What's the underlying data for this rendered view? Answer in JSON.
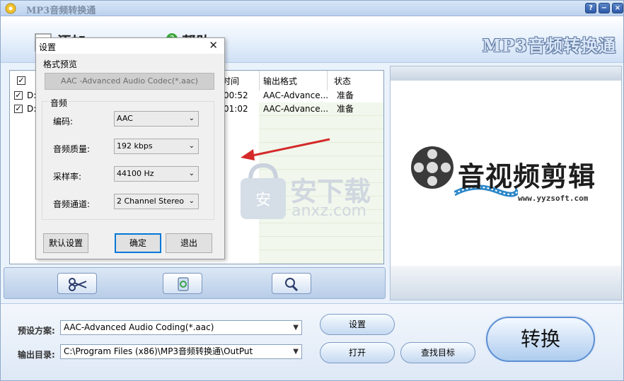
{
  "window": {
    "title": "MP3音频转换通",
    "brand_text": "MP3音频转换通",
    "controls": [
      "?",
      "−",
      "×"
    ]
  },
  "header": {
    "menu_add": "添加",
    "menu_help": "帮助"
  },
  "file_list": {
    "columns": [
      "时间",
      "输出格式",
      "状态"
    ],
    "rows": [
      {
        "checked": true,
        "name": "D:",
        "time": "00:52",
        "format": "AAC-Advance...",
        "status": "准备"
      },
      {
        "checked": true,
        "name": "D:",
        "time": "01:02",
        "format": "AAC-Advance...",
        "status": "准备"
      }
    ]
  },
  "watermark": {
    "preview_title": "音视频剪辑",
    "preview_url": "www.yyzsoft.com",
    "site_cn": "安下载",
    "site_en": "anxz.com"
  },
  "bottom": {
    "preset_label": "预设方案:",
    "preset_value": "AAC-Advanced Audio Coding(*.aac)",
    "output_label": "输出目录:",
    "output_value": "C:\\Program Files (x86)\\MP3音频转换通\\OutPut",
    "settings_button": "设置",
    "open_button": "打开",
    "find_button": "查找目标",
    "convert_button": "转换"
  },
  "dialog": {
    "title": "设置",
    "format_preview_label": "格式预览",
    "format_preview_value": "AAC -Advanced Audio Codec(*.aac)",
    "audio_group_label": "音频",
    "codec_label": "编码:",
    "codec_value": "AAC",
    "quality_label": "音频质量:",
    "quality_value": "192 kbps",
    "samplerate_label": "采样率:",
    "samplerate_value": "44100 Hz",
    "channel_label": "音频通道:",
    "channel_value": "2 Channel Stereo",
    "default_button": "默认设置",
    "ok_button": "确定",
    "exit_button": "退出"
  },
  "colors": {
    "accent": "#0078d7",
    "annotation_arrow": "#d42a2a",
    "title_text": "#7d8ea4"
  }
}
